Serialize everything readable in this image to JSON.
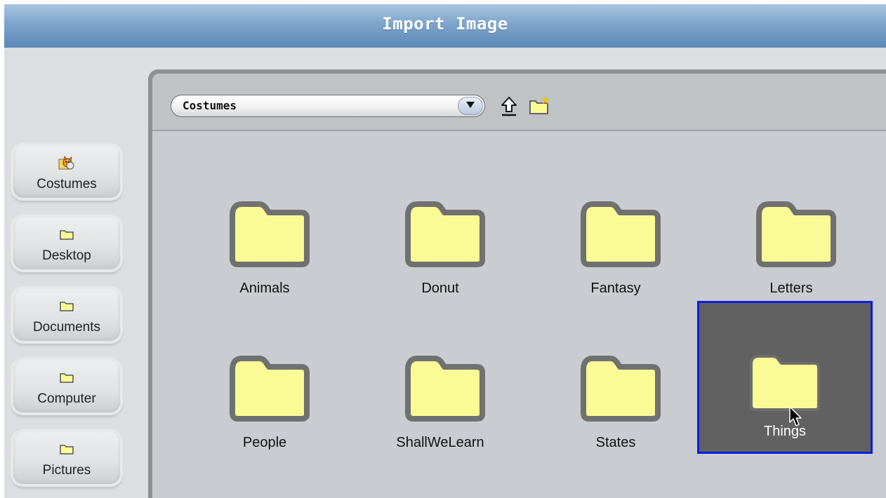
{
  "window": {
    "title": "Import Image"
  },
  "sidebar": {
    "items": [
      {
        "label": "Costumes",
        "icon": "costumes-cat-icon"
      },
      {
        "label": "Desktop",
        "icon": "folder-icon"
      },
      {
        "label": "Documents",
        "icon": "folder-icon"
      },
      {
        "label": "Computer",
        "icon": "folder-icon"
      },
      {
        "label": "Pictures",
        "icon": "folder-icon"
      }
    ]
  },
  "toolbar": {
    "path_value": "Costumes",
    "up_icon": "up-arrow-icon",
    "new_folder_icon": "new-folder-icon"
  },
  "folders": [
    {
      "label": "Animals"
    },
    {
      "label": "Donut"
    },
    {
      "label": "Fantasy"
    },
    {
      "label": "Letters"
    },
    {
      "label": "People"
    },
    {
      "label": "ShallWeLearn"
    },
    {
      "label": "States"
    },
    {
      "label": "Things",
      "selected": true
    }
  ],
  "colors": {
    "folder_fill": "#fafa96",
    "folder_border": "#707070",
    "selection_border": "#0d1ee0",
    "selection_bg": "#616161"
  }
}
